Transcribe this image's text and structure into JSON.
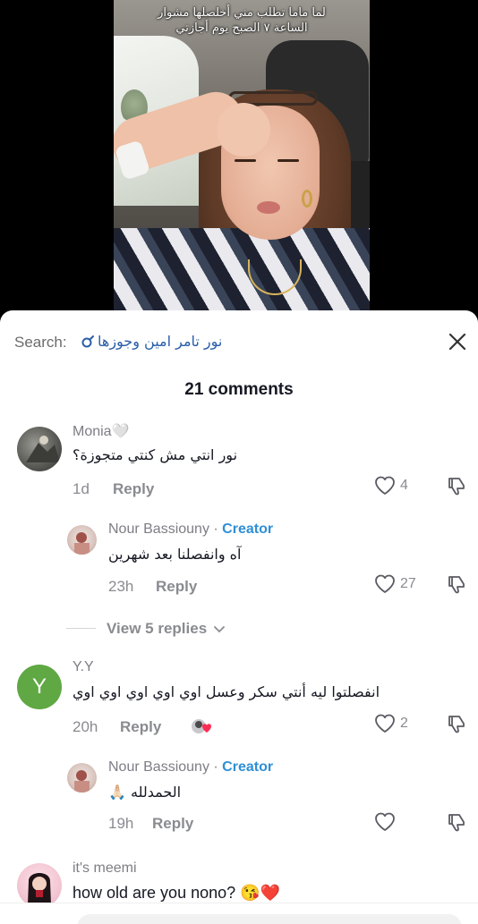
{
  "video": {
    "caption_line1": "لما ماما تطلب مني أخلصلها مشوار",
    "caption_line2": "الساعة ٧ الصبح يوم أجازتي"
  },
  "search": {
    "label": "Search:",
    "term": "نور تامر امين وجوزها"
  },
  "comments_header": "21 comments",
  "colors": {
    "creator": "#2f8fd6",
    "search_term": "#2a5ea8",
    "text": "#161823",
    "muted": "#8a8b91",
    "avatar_yy": "#5fa843"
  },
  "comments": [
    {
      "username": "Monia🤍",
      "text": "نور انتي مش كنتي متجوزة؟",
      "time": "1d",
      "reply_label": "Reply",
      "likes": "4"
    },
    {
      "username": "Nour Bassiouny",
      "separator": " · ",
      "badge": "Creator",
      "text": "آه وانفصلنا بعد شهرين",
      "time": "23h",
      "reply_label": "Reply",
      "likes": "27"
    },
    {
      "username": "Y.Y",
      "avatar_letter": "Y",
      "text": "انفصلتوا ليه أنتي سكر وعسل اوي اوي اوي اوي اوي",
      "time": "20h",
      "reply_label": "Reply",
      "likes": "2"
    },
    {
      "username": "Nour Bassiouny",
      "separator": " · ",
      "badge": "Creator",
      "text": "الحمدلله 🙏🏻",
      "time": "19h",
      "reply_label": "Reply",
      "likes": ""
    },
    {
      "username": "it's meemi",
      "text": "how old are you nono? 😘❤️"
    }
  ],
  "view_replies": "View 5 replies",
  "icons": {
    "search": "search-icon",
    "close": "close-icon",
    "like": "heart-outline-icon",
    "dislike": "thumbs-down-icon",
    "chevron": "chevron-down-icon"
  }
}
